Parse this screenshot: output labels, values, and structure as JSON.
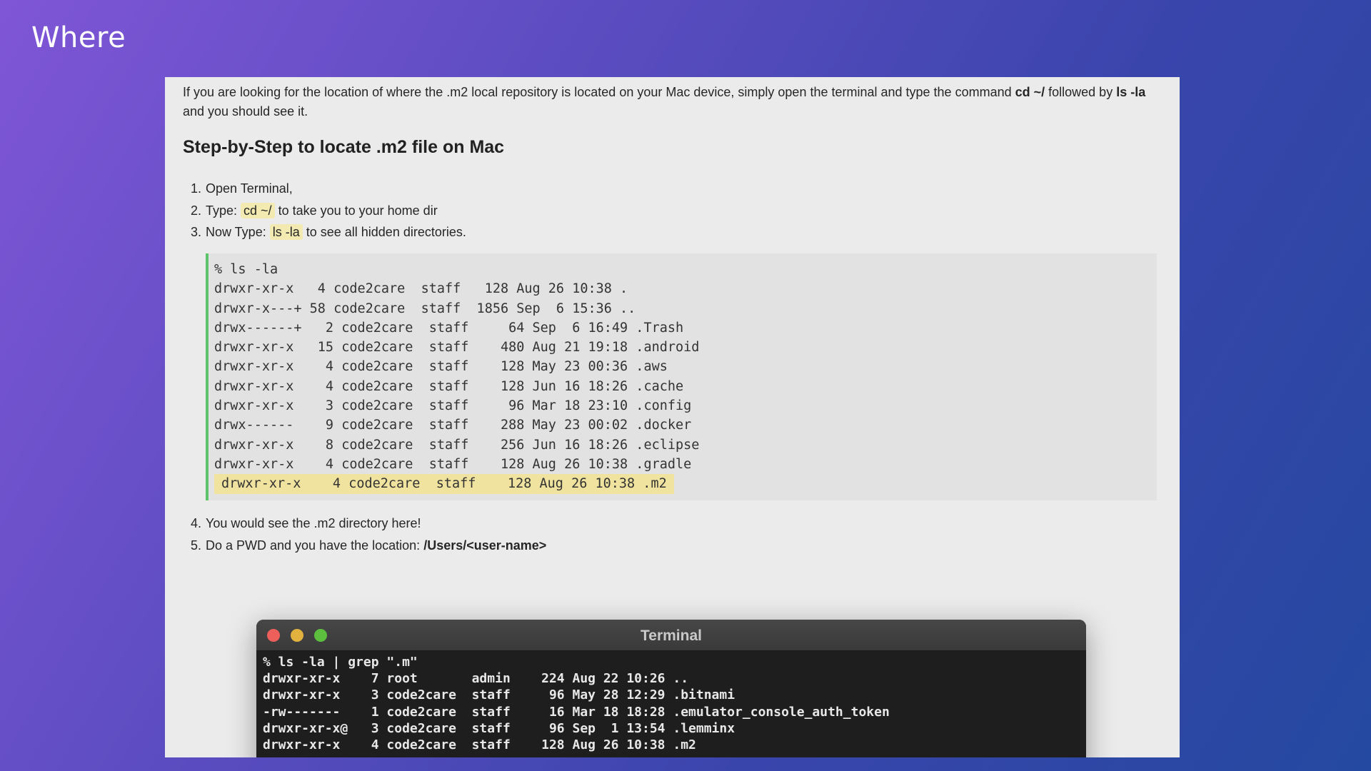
{
  "slide": {
    "title": "Where"
  },
  "intro": {
    "text_1": "If you are looking for the location of where the .m2 local repository is located on your Mac device, simply open the terminal and type the command ",
    "cmd_1": "cd ~/",
    "text_2": " followed by ",
    "cmd_2": "ls -la",
    "text_3": " and you should see it."
  },
  "heading": "Step-by-Step to locate .m2 file on Mac",
  "steps": [
    {
      "num": "1.",
      "text": "Open Terminal,"
    },
    {
      "num": "2.",
      "before": "Type: ",
      "code": "cd ~/",
      "after": " to take you to your home dir"
    },
    {
      "num": "3.",
      "before": "Now Type: ",
      "code": "ls -la",
      "after": " to see all hidden directories."
    }
  ],
  "code_block": {
    "lines": [
      "% ls -la",
      "drwxr-xr-x   4 code2care  staff   128 Aug 26 10:38 .",
      "drwxr-x---+ 58 code2care  staff  1856 Sep  6 15:36 ..",
      "drwx------+   2 code2care  staff     64 Sep  6 16:49 .Trash",
      "drwxr-xr-x   15 code2care  staff    480 Aug 21 19:18 .android",
      "drwxr-xr-x    4 code2care  staff    128 May 23 00:36 .aws",
      "drwxr-xr-x    4 code2care  staff    128 Jun 16 18:26 .cache",
      "drwxr-xr-x    3 code2care  staff     96 Mar 18 23:10 .config",
      "drwx------    9 code2care  staff    288 May 23 00:02 .docker",
      "drwxr-xr-x    8 code2care  staff    256 Jun 16 18:26 .eclipse",
      "drwxr-xr-x    4 code2care  staff    128 Aug 26 10:38 .gradle"
    ],
    "highlighted_line": "drwxr-xr-x    4 code2care  staff    128 Aug 26 10:38 .m2"
  },
  "steps_after": [
    {
      "num": "4.",
      "text": "You would see the .m2 directory here!"
    },
    {
      "num": "5.",
      "before": "Do a PWD and you have the location: ",
      "bold": "/Users/<user-name>"
    }
  ],
  "terminal": {
    "title": "Terminal",
    "lines": [
      "% ls -la | grep \".m\"",
      "drwxr-xr-x    7 root       admin    224 Aug 22 10:26 ..",
      "drwxr-xr-x    3 code2care  staff     96 May 28 12:29 .bitnami",
      "-rw-------    1 code2care  staff     16 Mar 18 18:28 .emulator_console_auth_token",
      "drwxr-xr-x@   3 code2care  staff     96 Sep  1 13:54 .lemminx",
      "drwxr-xr-x    4 code2care  staff    128 Aug 26 10:38 .m2"
    ]
  },
  "colors": {
    "code_accent": "#5ec46b",
    "inline_highlight": "#f3eab1",
    "close": "#ed5f5a",
    "minimize": "#e3b13e",
    "zoom": "#5cbf3e"
  }
}
